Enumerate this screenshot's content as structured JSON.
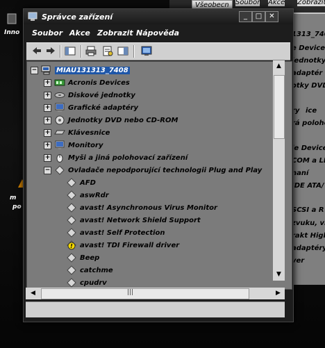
{
  "desktop": {
    "left_labels": [
      "Inno",
      "m",
      "po"
    ]
  },
  "background_window": {
    "tab": "Všeobecn",
    "menu": [
      "Soubor",
      "Akce",
      "Zobrazit"
    ],
    "lines": [
      "1313_740",
      "e Devices",
      "jednotky",
      "adaptér",
      "otky DVD",
      "ry",
      "ice",
      "rá polohov",
      "le Devices",
      "COM a LP",
      "naní",
      "IDE ATA/",
      "SCSI a R",
      "zvuku, vi",
      "rakt High",
      "adaptéry",
      "ver"
    ]
  },
  "window": {
    "title": "Správce zařízení",
    "menu": [
      "Soubor",
      "Akce",
      "Zobrazit",
      "Nápověda"
    ],
    "root": "MIAU131313_7408",
    "categories": [
      {
        "label": "Acronis Devices",
        "icon": "acronis-icon"
      },
      {
        "label": "Diskové jednotky",
        "icon": "disk-drive-icon"
      },
      {
        "label": "Grafické adaptéry",
        "icon": "display-adapter-icon"
      },
      {
        "label": "Jednotky DVD nebo CD-ROM",
        "icon": "dvd-drive-icon"
      },
      {
        "label": "Klávesnice",
        "icon": "keyboard-icon"
      },
      {
        "label": "Monitory",
        "icon": "monitor-icon"
      },
      {
        "label": "Myši a jiná polohovací zařízení",
        "icon": "mouse-icon"
      }
    ],
    "expanded": {
      "label": "Ovladače nepodporující technologii Plug and Play",
      "children": [
        {
          "label": "AFD",
          "warning": false
        },
        {
          "label": "aswRdr",
          "warning": false
        },
        {
          "label": "avast! Asynchronous Virus Monitor",
          "warning": false
        },
        {
          "label": "avast! Network Shield Support",
          "warning": false
        },
        {
          "label": "avast! Self Protection",
          "warning": false
        },
        {
          "label": "avast! TDI Firewall driver",
          "warning": true
        },
        {
          "label": "Beep",
          "warning": false
        },
        {
          "label": "catchme",
          "warning": false
        },
        {
          "label": "cpudrv",
          "warning": false
        }
      ]
    },
    "hscroll_grip": "|||"
  }
}
